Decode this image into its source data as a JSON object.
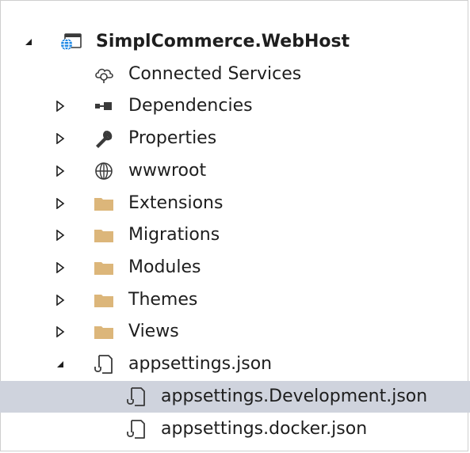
{
  "tree": {
    "root": {
      "label": "SimplCommerce.WebHost",
      "icon": "web-project-icon",
      "expanded": true
    },
    "items": [
      {
        "label": "Connected Services",
        "icon": "connected-services-icon"
      },
      {
        "label": "Dependencies",
        "icon": "dependencies-icon",
        "expanded": false
      },
      {
        "label": "Properties",
        "icon": "wrench-icon",
        "expanded": false
      },
      {
        "label": "wwwroot",
        "icon": "globe-icon",
        "expanded": false
      },
      {
        "label": "Extensions",
        "icon": "folder-icon",
        "expanded": false
      },
      {
        "label": "Migrations",
        "icon": "folder-icon",
        "expanded": false
      },
      {
        "label": "Modules",
        "icon": "folder-icon",
        "expanded": false
      },
      {
        "label": "Themes",
        "icon": "folder-icon",
        "expanded": false
      },
      {
        "label": "Views",
        "icon": "folder-icon",
        "expanded": false
      },
      {
        "label": "appsettings.json",
        "icon": "json-file-icon",
        "expanded": true
      },
      {
        "label": "appsettings.Development.json",
        "icon": "json-file-icon",
        "selected": true
      },
      {
        "label": "appsettings.docker.json",
        "icon": "json-file-icon"
      }
    ]
  },
  "colors": {
    "selection": "#cfd3dd",
    "folder": "#dcb67a",
    "text": "#1e1e1e",
    "project_blue": "#1e88e5"
  }
}
